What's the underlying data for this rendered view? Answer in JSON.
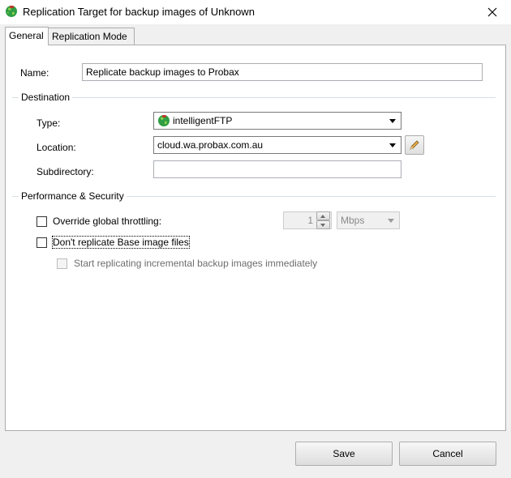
{
  "window": {
    "title": "Replication Target for backup images of Unknown",
    "icon": "green-globe-icon"
  },
  "tabs": [
    {
      "label": "General",
      "active": true
    },
    {
      "label": "Replication Mode",
      "active": false
    }
  ],
  "general": {
    "name_label": "Name:",
    "name_value": "Replicate backup images to Probax",
    "destination": {
      "group_title": "Destination",
      "type_label": "Type:",
      "type_value": "intelligentFTP",
      "location_label": "Location:",
      "location_value": "cloud.wa.probax.com.au",
      "subdirectory_label": "Subdirectory:",
      "subdirectory_value": ""
    },
    "performance": {
      "group_title": "Performance & Security",
      "override_throttling_label": "Override global throttling:",
      "override_throttling_checked": false,
      "throttle_value": "1",
      "throttle_unit": "Mbps",
      "dont_replicate_base_label": "Don't replicate Base image files",
      "dont_replicate_base_checked": false,
      "start_incremental_label": "Start replicating incremental backup images immediately",
      "start_incremental_checked": false
    }
  },
  "buttons": {
    "save": "Save",
    "cancel": "Cancel"
  },
  "colors": {
    "window_bg": "#f0f0f0",
    "panel_bg": "#ffffff",
    "disabled_text": "#6d6d6d",
    "icon_green": "#3aa93a"
  }
}
